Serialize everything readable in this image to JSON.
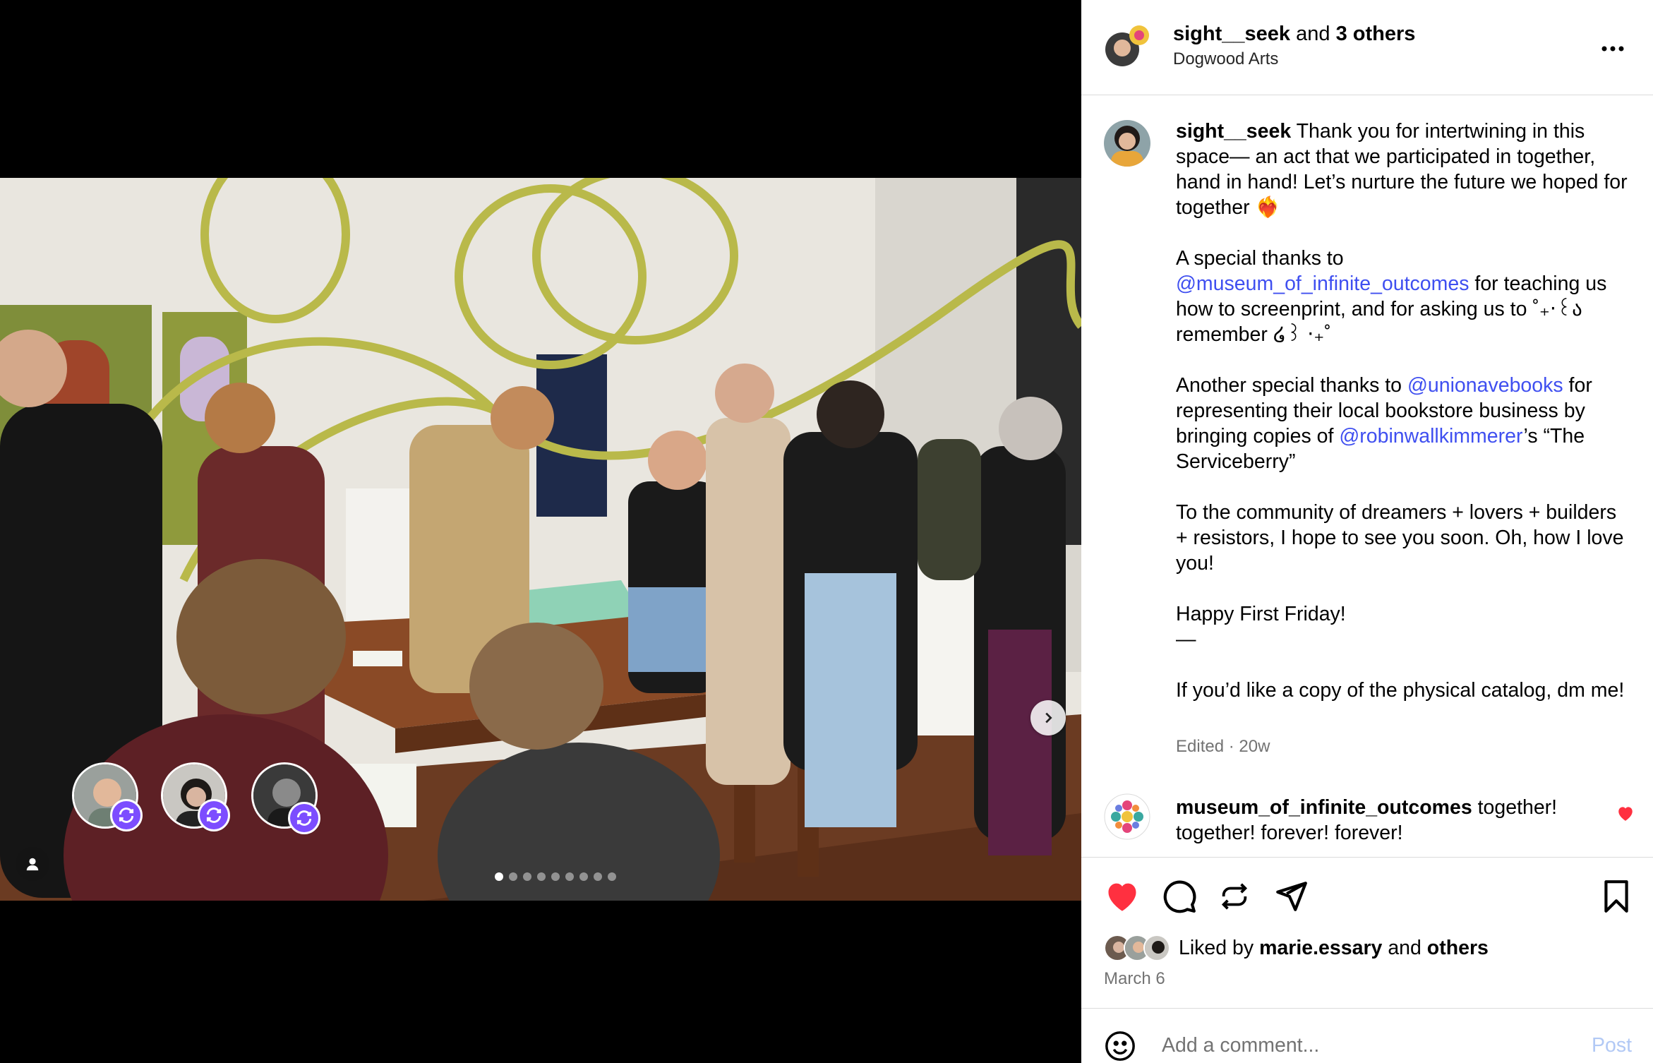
{
  "header": {
    "author": "sight__seek",
    "conjunction": "and",
    "others": "3 others",
    "location": "Dogwood Arts"
  },
  "caption": {
    "username": "sight__seek",
    "p1": "Thank you for intertwining in this space— an act that we participated in together, hand in hand! Let’s nurture the future we hoped for together ❤️‍🔥",
    "p2_a": "A special thanks to",
    "p2_link": "@museum_of_infinite_outcomes",
    "p2_b": "for teaching us how to screenprint, and for asking us to ˚₊‧꒰ა remember ໒꒱ ‧₊˚",
    "p3_a": "Another special thanks to",
    "p3_link1": "@unionavebooks",
    "p3_b": "for representing their local bookstore business by bringing copies of",
    "p3_link2": "@robinwallkimmerer",
    "p3_c": "’s “The Serviceberry”",
    "p4": "To the community of dreamers + lovers + builders + resistors, I hope to see you soon. Oh, how I love you!",
    "p5": "Happy First Friday!\n—",
    "p6": "If you’d like a copy of the physical catalog, dm me!",
    "meta": "Edited · 20w"
  },
  "comment": {
    "username": "museum_of_infinite_outcomes",
    "text": "together! together! forever! forever!"
  },
  "likes": {
    "prefix": "Liked by",
    "user": "marie.essary",
    "and": "and",
    "others": "others"
  },
  "date": "March 6",
  "add_comment": {
    "placeholder": "Add a comment...",
    "post": "Post"
  },
  "carousel": {
    "total": 9,
    "current": 1
  },
  "colors": {
    "accent": "#3f4ff0",
    "like": "#ff3040",
    "collab_badge": "#7c4dff"
  },
  "icons": [
    "more-icon",
    "heart-icon",
    "comment-icon",
    "repost-icon",
    "share-icon",
    "bookmark-icon",
    "emoji-icon",
    "chevron-right-icon",
    "user-tag-icon"
  ]
}
